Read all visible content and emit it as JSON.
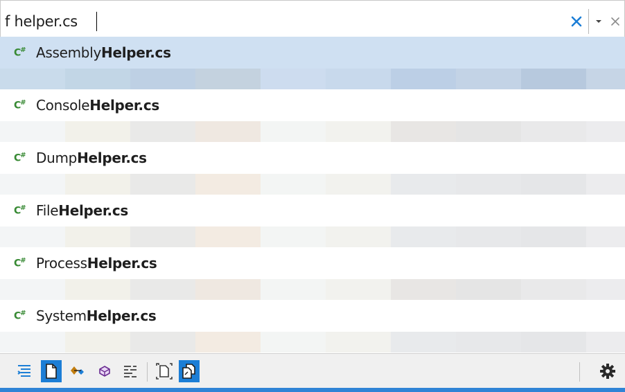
{
  "search": {
    "value": "f helper.cs"
  },
  "colors": {
    "accent": "#1c7ed6",
    "selected_row": "#cfe0f2",
    "csharp_icon": "#388a34",
    "status_strip": "#2f84d6"
  },
  "results": [
    {
      "icon": "csharp-file-icon",
      "prefix": "Assembly",
      "match": "Helper.cs",
      "selected": true
    },
    {
      "icon": "csharp-file-icon",
      "prefix": "Console",
      "match": "Helper.cs",
      "selected": false
    },
    {
      "icon": "csharp-file-icon",
      "prefix": "Dump",
      "match": "Helper.cs",
      "selected": false
    },
    {
      "icon": "csharp-file-icon",
      "prefix": "File",
      "match": "Helper.cs",
      "selected": false
    },
    {
      "icon": "csharp-file-icon",
      "prefix": "Process",
      "match": "Helper.cs",
      "selected": false
    },
    {
      "icon": "csharp-file-icon",
      "prefix": "System",
      "match": "Helper.cs",
      "selected": false
    }
  ],
  "toolbar": {
    "buttons": [
      {
        "name": "all-items-icon",
        "active": false
      },
      {
        "name": "files-icon",
        "active": true
      },
      {
        "name": "types-icon",
        "active": false
      },
      {
        "name": "members-icon",
        "active": false
      },
      {
        "name": "text-search-icon",
        "active": false
      },
      {
        "name": "current-document-icon",
        "active": false
      },
      {
        "name": "external-items-icon",
        "active": true
      },
      {
        "name": "gear-icon",
        "active": false
      }
    ]
  }
}
